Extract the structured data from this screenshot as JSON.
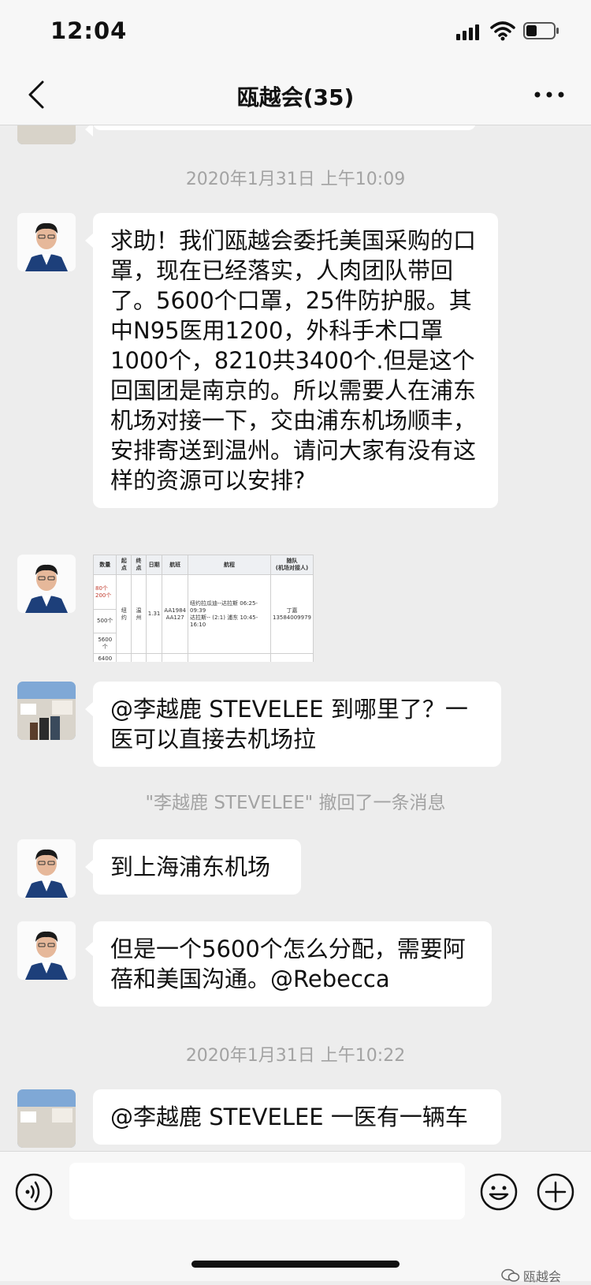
{
  "status": {
    "time": "12:04"
  },
  "nav": {
    "title": "瓯越会(35)"
  },
  "chat": {
    "timestamp1": "2020年1月31日 上午10:09",
    "msg1": "求助！我们瓯越会委托美国采购的口罩，现在已经落实，人肉团队带回了。5600个口罩，25件防护服。其中N95医用1200，外科手术口罩1000个，8210共3400个.但是这个回国团是南京的。所以需要人在浦东机场对接一下，交由浦东机场顺丰，安排寄送到温州。请问大家有没有这样的资源可以安排?",
    "image_table": {
      "headers": [
        "数量",
        "起点",
        "终点",
        "日期",
        "航班",
        "航程",
        "随队\n(机场对接人)"
      ],
      "quantities": [
        "80个",
        "200个",
        "500个",
        "5600个",
        "6400"
      ],
      "origin": "纽约",
      "destination": "温州",
      "date": "1.31",
      "flights": "AA1984\nAA127",
      "route": "纽约拉瓜迪--达拉斯 06:25-09:39\n达拉斯-- (2:1) 浦东 10:45-16:10",
      "contact": "丁嘉\n13584009979"
    },
    "msg2": "@李越鹿 STEVELEE 到哪里了？一医可以直接去机场拉",
    "system1": "\"李越鹿 STEVELEE\" 撤回了一条消息",
    "msg3": "到上海浦东机场",
    "msg4": "但是一个5600个怎么分配，需要阿蓓和美国沟通。@Rebecca",
    "timestamp2": "2020年1月31日 上午10:22",
    "msg5_partial": "@李越鹿 STEVELEE 一医有一辆车"
  },
  "watermark": {
    "text": "瓯越会"
  },
  "colors": {
    "bg": "#ededed",
    "bubble": "#ffffff",
    "timestamp": "#a3a3a3",
    "bar": "#f7f7f7"
  }
}
